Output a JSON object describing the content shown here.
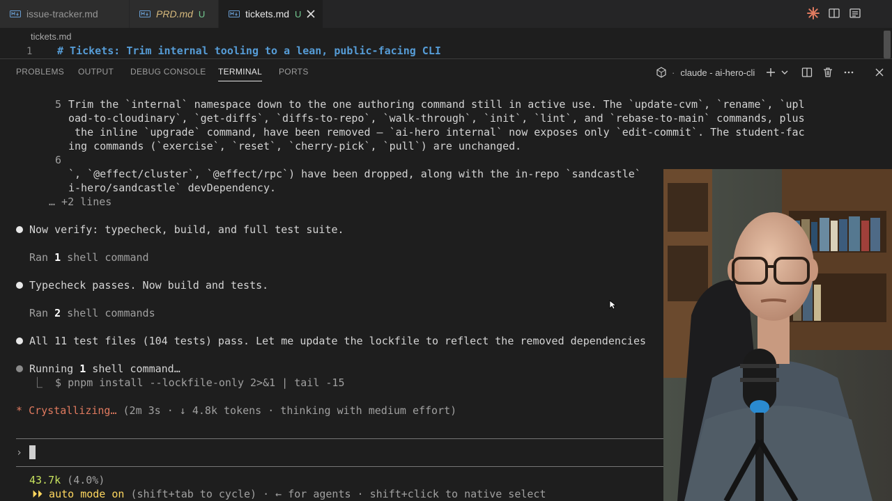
{
  "tabs": [
    {
      "label": "issue-tracker.md",
      "badge": "",
      "active": false,
      "italic": false
    },
    {
      "label": "PRD.md",
      "badge": "U",
      "active": false,
      "italic": true
    },
    {
      "label": "tickets.md",
      "badge": "U",
      "active": true,
      "italic": false
    }
  ],
  "breadcrumb": "tickets.md",
  "editor": {
    "line_number": "1",
    "line_text": "# Tickets: Trim internal tooling to a lean, public-facing CLI"
  },
  "panel": {
    "tabs": [
      "PROBLEMS",
      "OUTPUT",
      "DEBUG CONSOLE",
      "TERMINAL",
      "PORTS"
    ],
    "active_tab": "TERMINAL",
    "terminal_name": "claude - ai-hero-cli"
  },
  "terminal": {
    "diff5_num": "5",
    "diff5_l1": "Trim the `internal` namespace down to the one authoring command still in active use. The `update-cvm`, `rename`, `upl",
    "diff5_l2": "oad-to-cloudinary`, `get-diffs`, `diffs-to-repo`, `walk-through`, `init`, `lint`, and `rebase-to-main` commands, plus",
    "diff5_l3": " the inline `upgrade` command, have been removed — `ai-hero internal` now exposes only `edit-commit`. The student-fac",
    "diff5_l4": "ing commands (`exercise`, `reset`, `cherry-pick`, `pull`) are unchanged.",
    "diff6_num": "6",
    "diff6_l1": "`, `@effect/cluster`, `@effect/rpc`) have been dropped, along with the in-repo `sandcastle`",
    "diff6_l2": "i-hero/sandcastle` devDependency.",
    "more_lines": "… +2 lines",
    "msg1": "Now verify: typecheck, build, and full test suite.",
    "ran1_pre": "Ran ",
    "ran1_num": "1",
    "ran1_post": " shell command",
    "msg2": "Typecheck passes. Now build and tests.",
    "ran2_pre": "Ran ",
    "ran2_num": "2",
    "ran2_post": " shell commands",
    "msg3": "All 11 test files (104 tests) pass. Let me update the lockfile to reflect the removed dependencies",
    "running_pre": "Running ",
    "running_num": "1",
    "running_post": " shell command…",
    "running_cmd": "⎿  $ pnpm install --lockfile-only 2>&1 | tail -15",
    "status_star": "*",
    "status_word": "Crystallizing…",
    "status_info": " (2m 3s · ↓ 4.8k tokens · thinking with medium effort)",
    "prompt_symbol": "›",
    "tokens": "43.7k",
    "tokens_pct": " (4.0%)",
    "auto_arrows": "⏵⏵",
    "auto_label": " auto mode on",
    "auto_rest": " (shift+tab to cycle) · ← for agents · shift+click to native select"
  },
  "colors": {
    "accent_orange": "#e07a5f",
    "token_green": "#c7e25e",
    "auto_yellow": "#ffd75f",
    "heading_blue": "#569cd6",
    "untracked_green": "#73c991"
  }
}
